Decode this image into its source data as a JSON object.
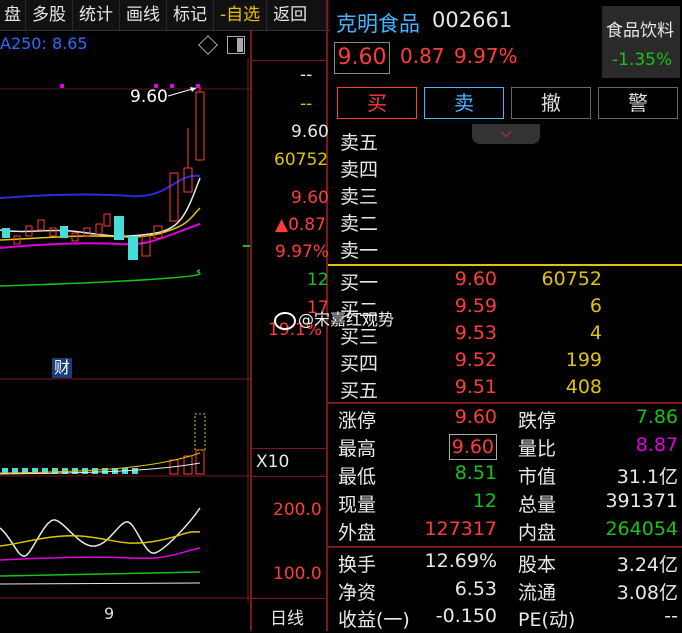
{
  "toolbar": {
    "items": [
      "盘",
      "多股",
      "统计",
      "画线",
      "标记",
      "-自选",
      "返回"
    ]
  },
  "chart": {
    "ma_label": "A250: 8.65",
    "high_marker": "9.60",
    "finance_badge": "财",
    "volume_multiplier": "X10",
    "indicator_levels": [
      "200.0",
      "100.0"
    ],
    "date_label": "9",
    "period": "日线"
  },
  "price_strip": {
    "dash1": "--",
    "dash2": "--",
    "price": "9.60",
    "volume": "60752",
    "price2": "9.60",
    "change": "▲0.87",
    "pct": "9.97%",
    "current_vol": "12",
    "partial_value": "17",
    "partial_pct": "19.1%"
  },
  "stock": {
    "name": "克明食品",
    "code": "002661",
    "price": "9.60",
    "change": "0.87",
    "pct": "9.97%",
    "sector_name": "食品饮料",
    "sector_change": "-1.35%"
  },
  "buttons": {
    "buy": "买",
    "sell": "卖",
    "cancel": "撤",
    "alert": "警"
  },
  "asks": [
    {
      "label": "卖五",
      "price": "",
      "vol": ""
    },
    {
      "label": "卖四",
      "price": "",
      "vol": ""
    },
    {
      "label": "卖三",
      "price": "",
      "vol": ""
    },
    {
      "label": "卖二",
      "price": "",
      "vol": ""
    },
    {
      "label": "卖一",
      "price": "",
      "vol": ""
    }
  ],
  "bids": [
    {
      "label": "买一",
      "price": "9.60",
      "vol": "60752"
    },
    {
      "label": "买二",
      "price": "9.59",
      "vol": "6"
    },
    {
      "label": "买三",
      "price": "9.53",
      "vol": "4"
    },
    {
      "label": "买四",
      "price": "9.52",
      "vol": "199"
    },
    {
      "label": "买五",
      "price": "9.51",
      "vol": "408"
    }
  ],
  "stats": [
    {
      "l1": "涨停",
      "v1": "9.60",
      "c1": "red",
      "l2": "跌停",
      "v2": "7.86",
      "c2": "green"
    },
    {
      "l1": "最高",
      "v1": "9.60",
      "c1": "red",
      "l2": "量比",
      "v2": "8.87",
      "c2": "purple"
    },
    {
      "l1": "最低",
      "v1": "8.51",
      "c1": "green",
      "l2": "市值",
      "v2": "31.1亿",
      "c2": "white"
    },
    {
      "l1": "现量",
      "v1": "12",
      "c1": "green",
      "l2": "总量",
      "v2": "391371",
      "c2": "white"
    },
    {
      "l1": "外盘",
      "v1": "127317",
      "c1": "red",
      "l2": "内盘",
      "v2": "264054",
      "c2": "green"
    }
  ],
  "stats2": [
    {
      "l1": "换手",
      "v1": "12.69%",
      "c1": "white",
      "l2": "股本",
      "v2": "3.24亿",
      "c2": "white"
    },
    {
      "l1": "净资",
      "v1": "6.53",
      "c1": "white",
      "l2": "流通",
      "v2": "3.08亿",
      "c2": "white"
    },
    {
      "l1": "收益(一)",
      "v1": "-0.150",
      "c1": "white",
      "l2": "PE(动)",
      "v2": "--",
      "c2": "white"
    }
  ],
  "watermark": "@宋嘉红观势",
  "colors": {
    "up": "#ff3c3c",
    "down": "#17c317",
    "accent": "#e0c400",
    "ma_purple": "#e000e0",
    "ma_blue": "#2b2bd8"
  }
}
